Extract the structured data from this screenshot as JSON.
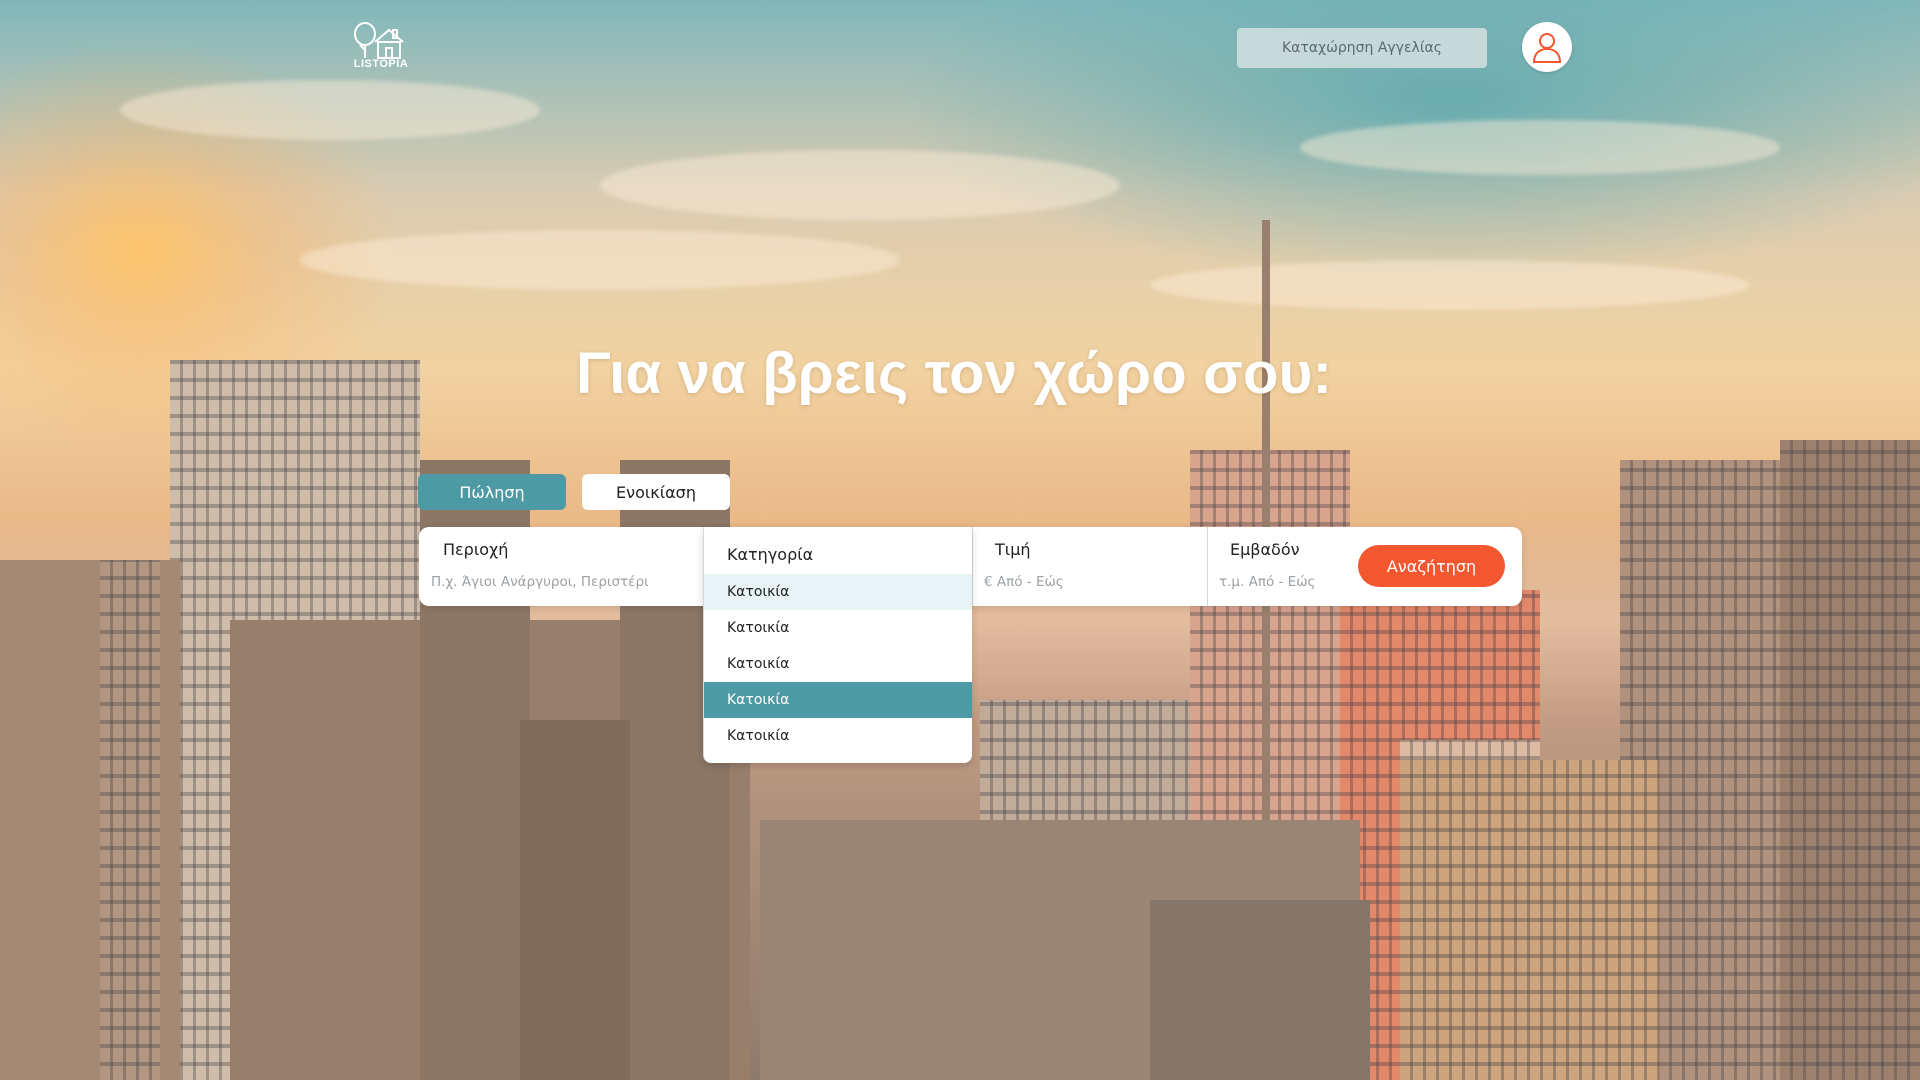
{
  "brand": {
    "name": "LISTOPIA",
    "logo_icon": "tree-and-house-icon"
  },
  "header": {
    "post_ad_label": "Καταχώρηση Αγγελίας",
    "user_icon": "user-icon"
  },
  "hero": {
    "title": "Για να βρεις τον χώρο σου:"
  },
  "tabs": [
    {
      "label": "Πώληση",
      "active": true
    },
    {
      "label": "Ενοικίαση",
      "active": false
    }
  ],
  "search": {
    "area": {
      "label": "Περιοχή",
      "placeholder": "Π.χ. Άγιοι Ανάργυροι, Περιστέρι"
    },
    "category": {
      "label": "Κατηγορία",
      "options": [
        {
          "label": "Κατοικία",
          "state": "hover"
        },
        {
          "label": "Κατοικία",
          "state": ""
        },
        {
          "label": "Κατοικία",
          "state": ""
        },
        {
          "label": "Κατοικία",
          "state": "selected"
        },
        {
          "label": "Κατοικία",
          "state": ""
        }
      ]
    },
    "price": {
      "label": "Τιμή",
      "placeholder": "€ Από - Εώς"
    },
    "size": {
      "label": "Εμβαδόν",
      "placeholder": "τ.μ. Από - Εώς"
    },
    "submit_label": "Αναζήτηση"
  },
  "colors": {
    "accent_teal": "#4e9aa4",
    "search_orange": "#f2572f"
  }
}
